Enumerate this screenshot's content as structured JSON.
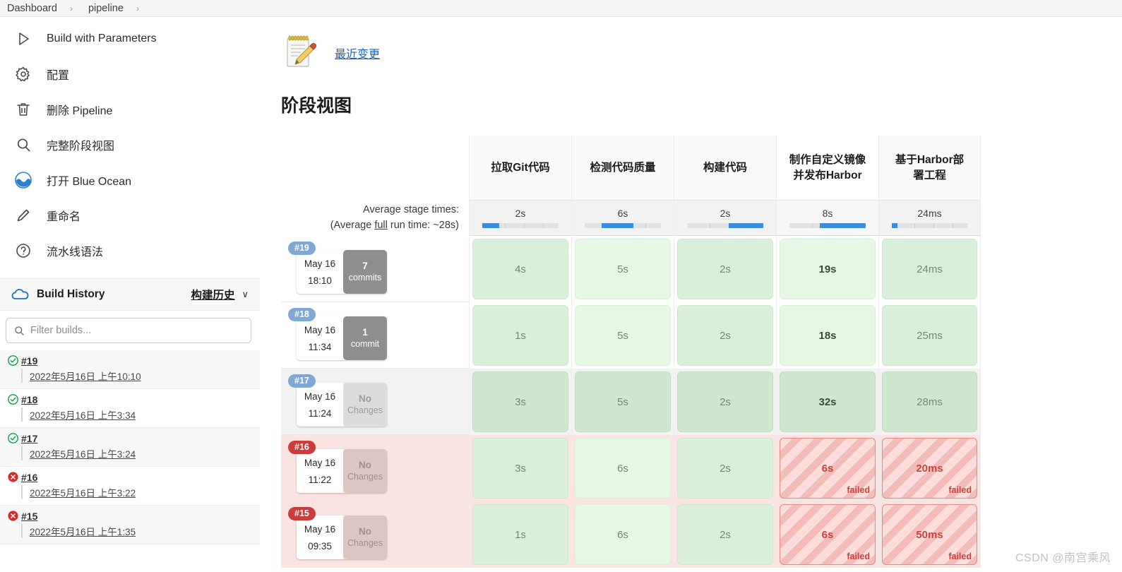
{
  "breadcrumb": {
    "items": [
      "Dashboard",
      "pipeline"
    ],
    "separator": "›"
  },
  "sidebar": {
    "nav": [
      {
        "label": "Build with Parameters",
        "icon": "play-icon"
      },
      {
        "label": "配置",
        "icon": "gear-icon"
      },
      {
        "label": "删除 Pipeline",
        "icon": "trash-icon"
      },
      {
        "label": "完整阶段视图",
        "icon": "search-icon"
      },
      {
        "label": "打开 Blue Ocean",
        "icon": "blue-ocean-icon"
      },
      {
        "label": "重命名",
        "icon": "pencil-icon"
      },
      {
        "label": "流水线语法",
        "icon": "question-icon"
      }
    ],
    "build_history": {
      "title": "Build History",
      "link_label": "构建历史",
      "chevron": "∨",
      "filter_placeholder": "Filter builds...",
      "builds": [
        {
          "number": "#19",
          "date": "2022年5月16日 上午10:10",
          "status": "success"
        },
        {
          "number": "#18",
          "date": "2022年5月16日 上午3:34",
          "status": "success"
        },
        {
          "number": "#17",
          "date": "2022年5月16日 上午3:24",
          "status": "success"
        },
        {
          "number": "#16",
          "date": "2022年5月16日 上午3:22",
          "status": "failed"
        },
        {
          "number": "#15",
          "date": "2022年5月16日 上午1:35",
          "status": "failed"
        }
      ]
    }
  },
  "main": {
    "changes_link": "最近变更",
    "page_title": "阶段视图",
    "avg_label_line1": "Average stage times:",
    "avg_label_line2_pre": "(Average ",
    "avg_label_line2_u": "full",
    "avg_label_line2_post": " run time: ~28s)"
  },
  "chart_data": {
    "type": "table",
    "title": "阶段视图",
    "columns": [
      "拉取Git代码",
      "检测代码质量",
      "构建代码",
      "制作自定义镜像并发布Harbor",
      "基于Harbor部署工程"
    ],
    "column_lines": [
      [
        "拉取Git代码"
      ],
      [
        "检测代码质量"
      ],
      [
        "构建代码"
      ],
      [
        "制作自定义镜像",
        "并发布Harbor"
      ],
      [
        "基于Harbor部",
        "署工程"
      ]
    ],
    "average_stage_times": [
      "2s",
      "6s",
      "2s",
      "8s",
      "24ms"
    ],
    "average_bar_fill_pct": [
      22,
      42,
      64,
      76,
      8
    ],
    "average_bar_offset_pct": [
      0,
      22,
      55,
      40,
      0
    ],
    "average_full_run_time": "~28s",
    "rows": [
      {
        "build": "#19",
        "date": "May 16",
        "time": "18:10",
        "commits_count": "7",
        "commits_label": "commits",
        "status": "success",
        "highlighted": false,
        "cells": [
          {
            "value": "4s",
            "state": "success"
          },
          {
            "value": "5s",
            "state": "success"
          },
          {
            "value": "2s",
            "state": "success"
          },
          {
            "value": "19s",
            "state": "success"
          },
          {
            "value": "24ms",
            "state": "success"
          }
        ]
      },
      {
        "build": "#18",
        "date": "May 16",
        "time": "11:34",
        "commits_count": "1",
        "commits_label": "commit",
        "status": "success",
        "highlighted": false,
        "cells": [
          {
            "value": "1s",
            "state": "success"
          },
          {
            "value": "5s",
            "state": "success"
          },
          {
            "value": "2s",
            "state": "success"
          },
          {
            "value": "18s",
            "state": "success"
          },
          {
            "value": "25ms",
            "state": "success"
          }
        ]
      },
      {
        "build": "#17",
        "date": "May 16",
        "time": "11:24",
        "commits_count": "No",
        "commits_label": "Changes",
        "status": "success",
        "highlighted": true,
        "cells": [
          {
            "value": "3s",
            "state": "success"
          },
          {
            "value": "5s",
            "state": "success"
          },
          {
            "value": "2s",
            "state": "success"
          },
          {
            "value": "32s",
            "state": "success"
          },
          {
            "value": "28ms",
            "state": "success"
          }
        ]
      },
      {
        "build": "#16",
        "date": "May 16",
        "time": "11:22",
        "commits_count": "No",
        "commits_label": "Changes",
        "status": "failed",
        "highlighted": false,
        "cells": [
          {
            "value": "3s",
            "state": "success"
          },
          {
            "value": "6s",
            "state": "success"
          },
          {
            "value": "2s",
            "state": "success"
          },
          {
            "value": "6s",
            "state": "failed",
            "tag": "failed"
          },
          {
            "value": "20ms",
            "state": "failed",
            "tag": "failed"
          }
        ]
      },
      {
        "build": "#15",
        "date": "May 16",
        "time": "09:35",
        "commits_count": "No",
        "commits_label": "Changes",
        "status": "failed",
        "highlighted": false,
        "cells": [
          {
            "value": "1s",
            "state": "success"
          },
          {
            "value": "6s",
            "state": "success"
          },
          {
            "value": "2s",
            "state": "success"
          },
          {
            "value": "6s",
            "state": "failed",
            "tag": "failed"
          },
          {
            "value": "50ms",
            "state": "failed",
            "tag": "failed"
          }
        ]
      }
    ]
  },
  "watermark": "CSDN @南宫乘风",
  "colors": {
    "accent_blue": "#1464c8",
    "bar_blue": "#3c8ddc",
    "success_green": "#d9efd9",
    "fail_red": "#c9423f",
    "badge_blue": "#7fa8d4",
    "badge_red": "#cd3b3b"
  }
}
